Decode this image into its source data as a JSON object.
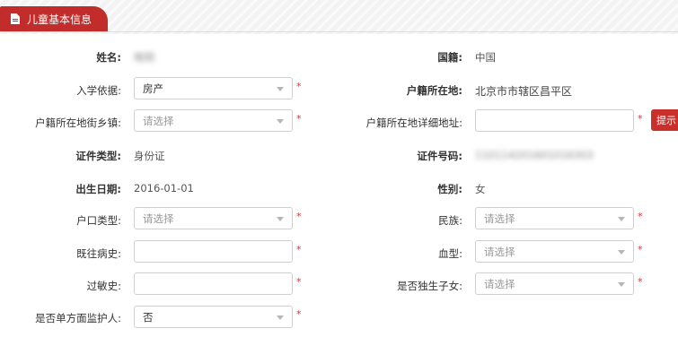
{
  "tab": {
    "title": "儿童基本信息",
    "icon": "document-icon"
  },
  "fields": {
    "name": {
      "label": "姓名:",
      "value": "晓玥"
    },
    "nationality": {
      "label": "国籍:",
      "value": "中国"
    },
    "admission_basis": {
      "label": "入学依据:",
      "value": "房产"
    },
    "household_location": {
      "label": "户籍所在地:",
      "value": "北京市市辖区昌平区"
    },
    "household_street": {
      "label": "户籍所在地街乡镇:",
      "placeholder": "请选择"
    },
    "household_address": {
      "label": "户籍所在地详细地址:",
      "value": ""
    },
    "id_type": {
      "label": "证件类型:",
      "value": "身份证"
    },
    "id_number": {
      "label": "证件号码:",
      "value": "110114201601016303"
    },
    "birth_date": {
      "label": "出生日期:",
      "value": "2016-01-01"
    },
    "gender": {
      "label": "性别:",
      "value": "女"
    },
    "hukou_type": {
      "label": "户口类型:",
      "placeholder": "请选择"
    },
    "ethnicity": {
      "label": "民族:",
      "placeholder": "请选择"
    },
    "medical_history": {
      "label": "既往病史:",
      "value": ""
    },
    "blood_type": {
      "label": "血型:",
      "placeholder": "请选择"
    },
    "allergy_history": {
      "label": "过敏史:",
      "value": ""
    },
    "only_child": {
      "label": "是否独生子女:",
      "placeholder": "请选择"
    },
    "single_guardian": {
      "label": "是否单方面监护人:",
      "value": "否"
    }
  },
  "required_mark": "*",
  "tip_button": "提示"
}
